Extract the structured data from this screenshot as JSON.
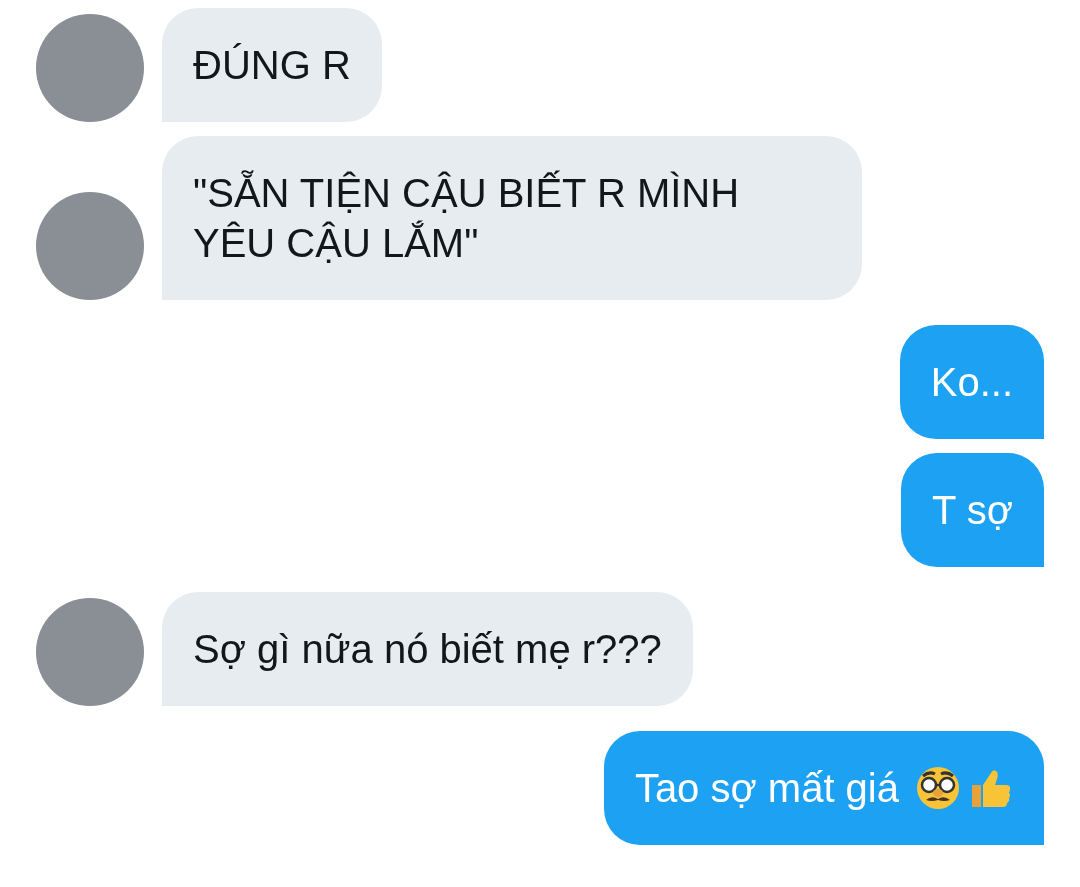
{
  "messages": [
    {
      "kind": "incoming",
      "text": "ĐÚNG R",
      "avatar": true
    },
    {
      "kind": "incoming",
      "text": "\"SẴN TIỆN CẬU BIẾT R MÌNH YÊU CẬU LẮM\"",
      "avatar": true
    },
    {
      "kind": "outgoing",
      "text": "Ko..."
    },
    {
      "kind": "outgoing",
      "text": "T sợ"
    },
    {
      "kind": "incoming",
      "text": "Sợ gì nữa nó biết mẹ r???",
      "avatar": true
    },
    {
      "kind": "outgoing",
      "text": "Tao sợ mất giá",
      "emojis": [
        {
          "kind": "disguised_face"
        },
        {
          "kind": "thumbs_up"
        }
      ]
    }
  ]
}
